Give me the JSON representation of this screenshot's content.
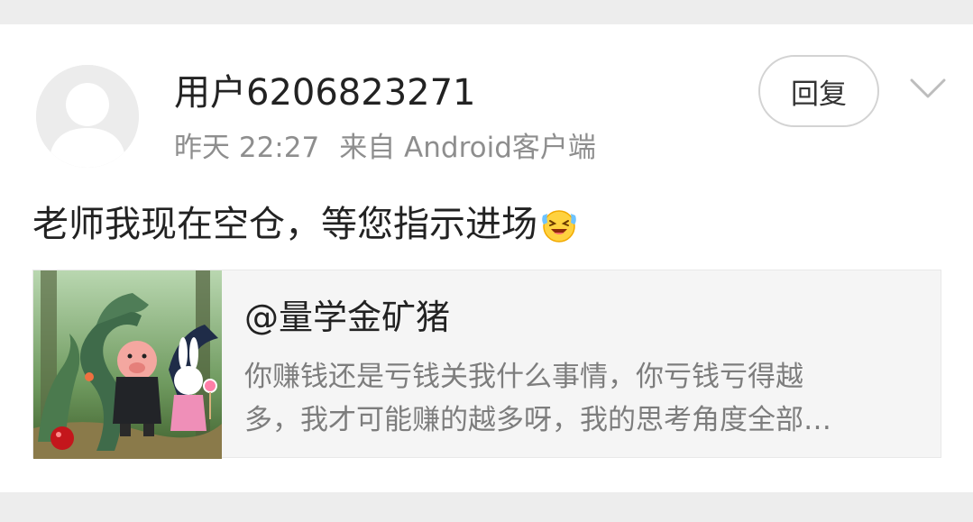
{
  "comment": {
    "username": "用户6206823271",
    "time": "昨天 22:27",
    "source": "来自 Android客户端",
    "reply_label": "回复",
    "text": "老师我现在空仓，等您指示进场",
    "avatar_icon": "default-user-avatar-icon",
    "emoji_icon": "crying-laughing-emoji-icon",
    "chevron_icon": "chevron-down-icon"
  },
  "quoted_post": {
    "author": "@量学金矿猪",
    "text_line1": "你赚钱还是亏钱关我什么事情，你亏钱亏得越",
    "text_line2": "多，我才可能赚的越多呀，我的思考角度全部…",
    "thumbnail": "cartoon-pig-rabbit-dragons-forest-image"
  },
  "colors": {
    "page_background": "#ededed",
    "card_background": "#ffffff",
    "primary_text": "#222222",
    "secondary_text": "#8e8e8e",
    "quote_background": "#f5f5f5"
  }
}
